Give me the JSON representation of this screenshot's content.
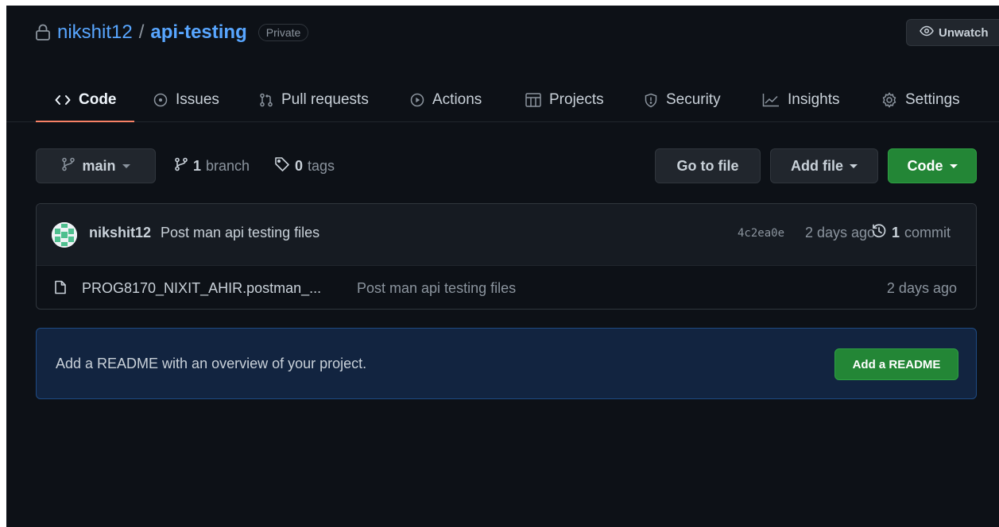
{
  "repo": {
    "owner": "nikshit12",
    "separator": "/",
    "name": "api-testing",
    "visibility": "Private"
  },
  "header": {
    "unwatch_label": "Unwatch"
  },
  "tabs": [
    {
      "label": "Code",
      "icon": "code-icon",
      "selected": true
    },
    {
      "label": "Issues",
      "icon": "issue-icon"
    },
    {
      "label": "Pull requests",
      "icon": "pull-request-icon"
    },
    {
      "label": "Actions",
      "icon": "play-icon"
    },
    {
      "label": "Projects",
      "icon": "table-icon"
    },
    {
      "label": "Security",
      "icon": "shield-icon"
    },
    {
      "label": "Insights",
      "icon": "graph-icon"
    },
    {
      "label": "Settings",
      "icon": "gear-icon"
    }
  ],
  "branch_bar": {
    "branch_name": "main",
    "branch_count": "1",
    "branch_label": "branch",
    "tag_count": "0",
    "tag_label": "tags",
    "go_to_file": "Go to file",
    "add_file": "Add file",
    "code": "Code"
  },
  "commit": {
    "author": "nikshit12",
    "message": "Post man api testing files",
    "sha": "4c2ea0e",
    "age": "2 days ago",
    "count": "1",
    "count_label": "commit"
  },
  "files": [
    {
      "name": "PROG8170_NIXIT_AHIR.postman_...",
      "message": "Post man api testing files",
      "age": "2 days ago"
    }
  ],
  "readme": {
    "text": "Add a README with an overview of your project.",
    "button": "Add a README"
  },
  "colors": {
    "background": "#0d1117",
    "link": "#58a6ff",
    "primary_button": "#238636",
    "selected_tab_underline": "#f78166",
    "readme_banner": "#122440"
  }
}
